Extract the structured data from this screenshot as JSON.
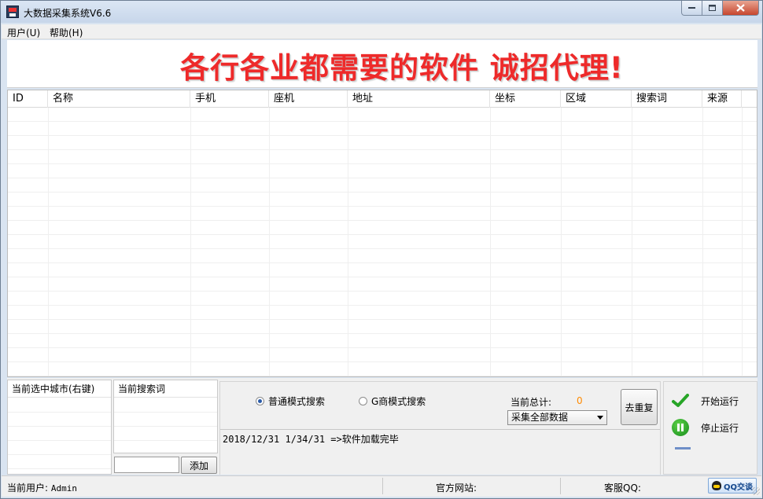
{
  "window": {
    "title": "大数据采集系统V6.6"
  },
  "menu": {
    "items": [
      "用户(U)",
      "帮助(H)"
    ]
  },
  "banner": {
    "text": "各行各业都需要的软件  诚招代理!"
  },
  "grid": {
    "columns": [
      "ID",
      "名称",
      "手机",
      "座机",
      "地址",
      "坐标",
      "区域",
      "搜索词",
      "来源"
    ]
  },
  "city_panel": {
    "header": "当前选中城市(右键)"
  },
  "keyword_panel": {
    "header": "当前搜索词",
    "input_value": "",
    "add_label": "添加"
  },
  "search": {
    "mode_normal": "普通模式搜索",
    "mode_g": "G商模式搜索",
    "selected_mode": "普通模式搜索",
    "total_label": "当前总计:",
    "total_value": "0",
    "scope_selected": "采集全部数据",
    "dedupe_label": "去重复"
  },
  "log": {
    "line": "2018/12/31 1/34/31 =>软件加载完毕"
  },
  "controls": {
    "start_label": "开始运行",
    "stop_label": "停止运行"
  },
  "status": {
    "user_label": "当前用户:",
    "user_value": "Admin",
    "site_label": "官方网站:",
    "qq_label": "客服QQ:",
    "qq_button": "QQ交谈"
  },
  "colors": {
    "banner_red": "#ee2a2a",
    "total_orange": "#ff8a00",
    "title_bg": "#d3dff0"
  },
  "icons": [
    "app-icon",
    "minimize-icon",
    "maximize-icon",
    "close-icon",
    "check-icon",
    "pause-icon",
    "qq-icon",
    "dropdown-arrow-icon"
  ]
}
